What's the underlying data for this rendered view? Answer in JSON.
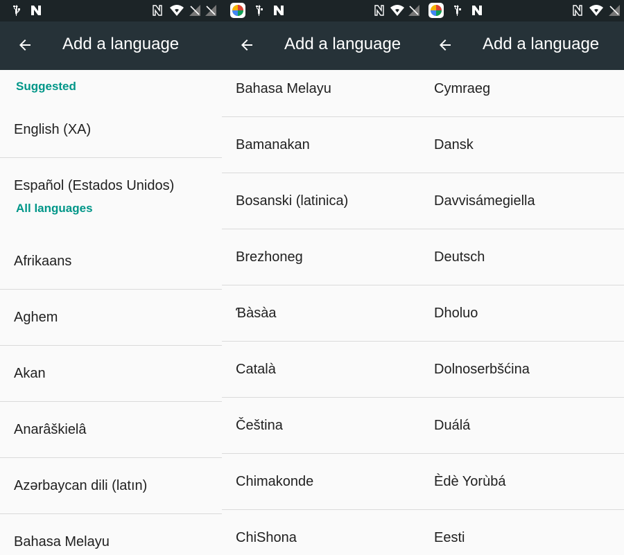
{
  "colors": {
    "status_bar": "#1c2427",
    "app_bar": "#263238",
    "accent": "#009688",
    "background": "#fafafa",
    "divider": "#dadada"
  },
  "panel1": {
    "title": "Add a language",
    "suggested_header": "Suggested",
    "suggested": [
      "English (XA)",
      "Español (Estados Unidos)"
    ],
    "all_header": "All languages",
    "languages": [
      "Afrikaans",
      "Aghem",
      "Akan",
      "Anarâškielâ",
      "Azərbaycan dili (latın)",
      "Bahasa Melayu"
    ]
  },
  "panel2": {
    "title": "Add a language",
    "languages": [
      "Bahasa Melayu",
      "Bamanakan",
      "Bosanski (latinica)",
      "Brezhoneg",
      "Ɓàsàa",
      "Català",
      "Čeština",
      "Chimakonde",
      "ChiShona"
    ]
  },
  "panel3": {
    "title": "Add a language",
    "languages": [
      "Cymraeg",
      "Dansk",
      "Davvisámegiella",
      "Deutsch",
      "Dholuo",
      "Dolnoserbšćina",
      "Duálá",
      "Èdè Yorùbá",
      "Eesti"
    ]
  },
  "icons": {
    "usb": "usb-icon",
    "nfc": "nfc-icon",
    "wifi": "wifi-icon",
    "signal": "signal-icon",
    "app": "app-icon",
    "back": "back-arrow-icon"
  }
}
